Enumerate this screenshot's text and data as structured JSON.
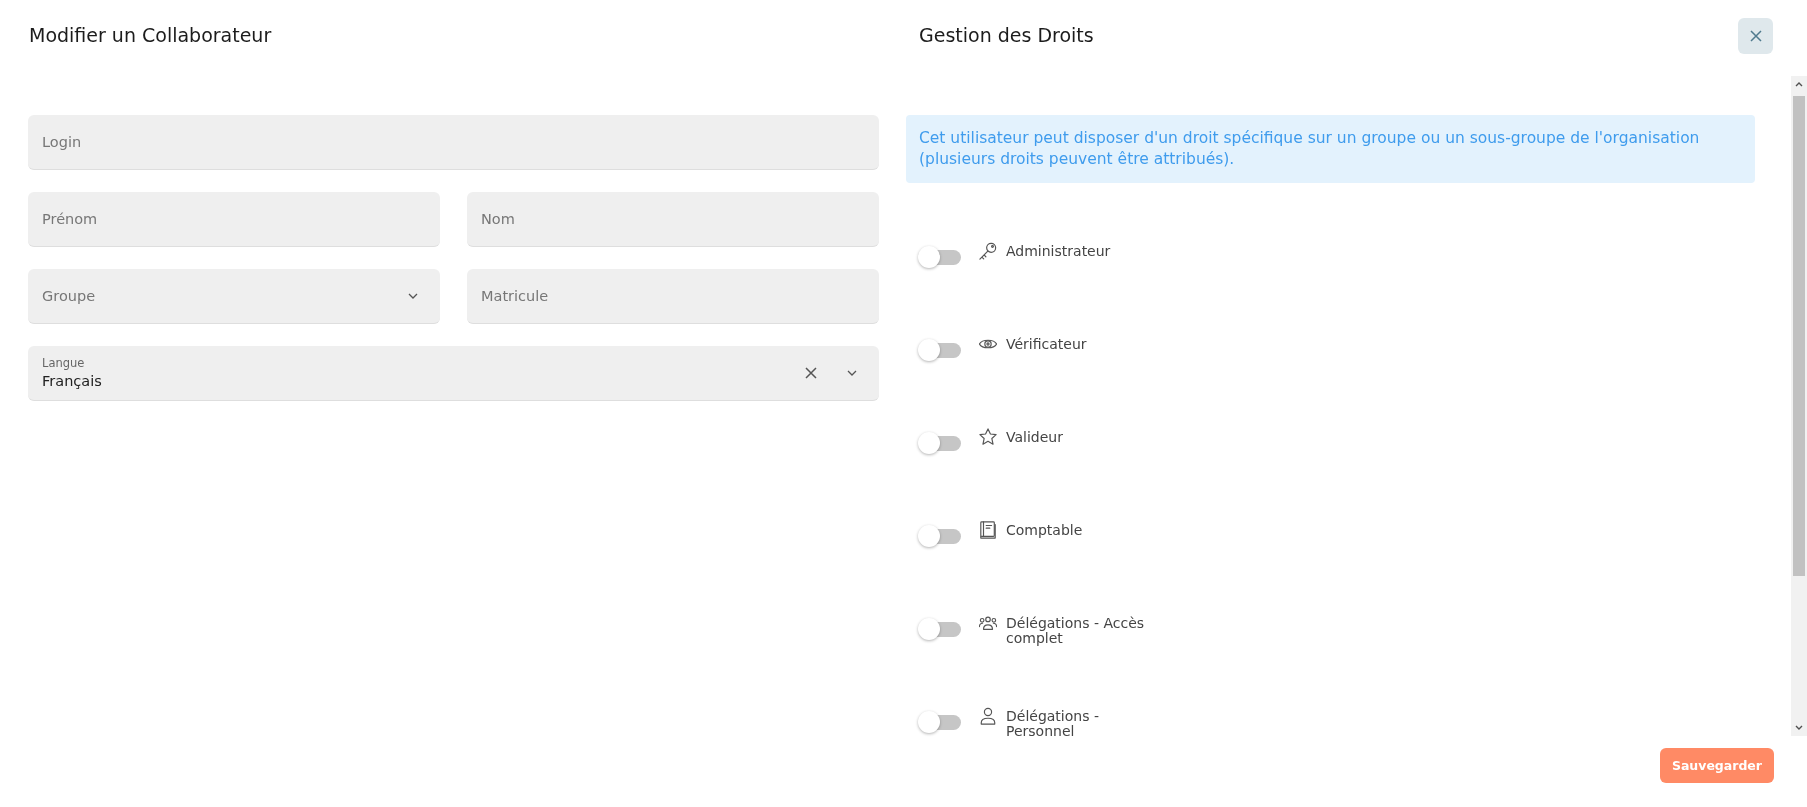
{
  "form": {
    "title": "Modifier un Collaborateur",
    "rows": [
      {
        "fields": [
          {
            "kind": "text",
            "placeholder": "Login"
          }
        ]
      },
      {
        "fields": [
          {
            "kind": "text",
            "placeholder": "Prénom"
          },
          {
            "kind": "text",
            "placeholder": "Nom"
          }
        ]
      },
      {
        "fields": [
          {
            "kind": "select",
            "placeholder": "Groupe"
          },
          {
            "kind": "text",
            "placeholder": "Matricule"
          }
        ]
      },
      {
        "fields": [
          {
            "kind": "select",
            "label": "Langue",
            "value": "Français"
          }
        ]
      }
    ]
  },
  "rights_panel": {
    "title": "Gestion des Droits",
    "info": "Cet utilisateur peut disposer d'un droit spécifique sur un groupe ou un sous-groupe de l'organisation (plusieurs droits peuvent être attribués).",
    "rights": [
      {
        "label": "Administrateur",
        "on": false
      },
      {
        "label": "Vérificateur",
        "on": false
      },
      {
        "label": "Valideur",
        "on": false
      },
      {
        "label": "Comptable",
        "on": false
      },
      {
        "label": "Délégations - Accès complet",
        "on": false
      },
      {
        "label": "Délégations - Personnel",
        "on": false
      }
    ]
  },
  "save_button": "Sauvegarder"
}
